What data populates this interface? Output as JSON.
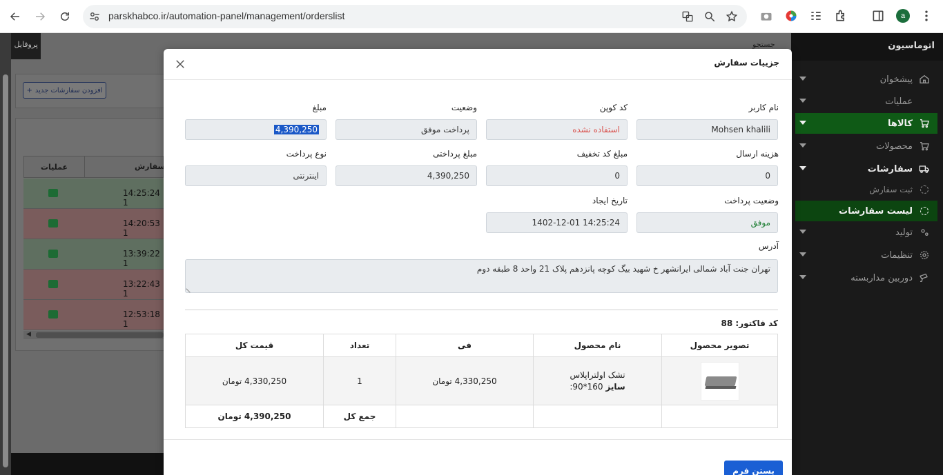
{
  "browser": {
    "url": "parskhabco.ir/automation-panel/management/orderslist",
    "avatar_letter": "a"
  },
  "background": {
    "profile_label": "پروفایل",
    "search_label": "جستجو",
    "add_order_label": "افزودن سفارشات جدید",
    "table": {
      "col_ops": "عملیات",
      "col_order": "سفارش",
      "rows": [
        {
          "time": "14:25:24 1",
          "status": "green"
        },
        {
          "time": "14:20:53 1",
          "status": "red"
        },
        {
          "time": "13:39:22 1",
          "status": "green"
        },
        {
          "time": "13:22:43 1",
          "status": "red"
        },
        {
          "time": "12:53:18 1",
          "status": "red"
        }
      ]
    }
  },
  "sidebar": {
    "brand": "اتوماسیون",
    "items": [
      {
        "label": "پیشخوان",
        "icon": "home-icon"
      },
      {
        "label": "عملیات",
        "icon": ""
      },
      {
        "label": "کالاها",
        "icon": "cart-icon"
      },
      {
        "label": "محصولات",
        "icon": "cart-icon"
      },
      {
        "label": "سفارشات",
        "icon": "truck-icon"
      },
      {
        "label": "ثبت سفارش",
        "icon": "circle-icon"
      },
      {
        "label": "لیست سفارشات",
        "icon": "circle-icon"
      },
      {
        "label": "تولید",
        "icon": "gears-icon"
      },
      {
        "label": "تنظیمات",
        "icon": "gear-icon"
      },
      {
        "label": "دوربین مداربسته",
        "icon": "camera-icon"
      }
    ]
  },
  "modal": {
    "title": "جزییات سفارش",
    "fields": {
      "username": {
        "label": "نام کاربر",
        "value": "Mohsen khalili"
      },
      "coupon": {
        "label": "کد کوپن",
        "value": "استفاده نشده"
      },
      "status": {
        "label": "وضعیت",
        "value": "پرداخت موفق"
      },
      "amount": {
        "label": "مبلغ",
        "value": "4,390,250"
      },
      "shipping": {
        "label": "هزینه ارسال",
        "value": "0"
      },
      "discount": {
        "label": "مبلغ کد تخفیف",
        "value": "0"
      },
      "paid": {
        "label": "مبلغ پرداختی",
        "value": "4,390,250"
      },
      "pay_type": {
        "label": "نوع پرداخت",
        "value": "اینترنتی"
      },
      "pay_status": {
        "label": "وضعیت پرداخت",
        "value": "موفق"
      },
      "created": {
        "label": "تاریخ ایجاد",
        "value": "1402-12-01 14:25:24"
      },
      "address": {
        "label": "آدرس",
        "value": "تهران جنت آباد شمالی ایرانشهر خ شهید بیگ کوچه پانزدهم پلاک 21 واحد 8 طبقه دوم"
      }
    },
    "invoice_label": "کد فاکتور: 88",
    "table": {
      "headers": [
        "تصویر محصول",
        "نام محصول",
        "فی",
        "تعداد",
        "قیمت کل"
      ],
      "row": {
        "name": "تشک اولتراپلاس",
        "size_label": "سایز",
        "size_value": ":90*160",
        "unit_price": "4,330,250 تومان",
        "qty": "1",
        "total": "4,330,250 تومان"
      },
      "sum_label": "جمع کل",
      "sum_value": "4,390,250 تومان"
    },
    "close_button": "بستن فرم"
  },
  "colors": {
    "sidebar_active": "#0f5a16",
    "primary_button": "#1a5fd4",
    "unused_coupon": "#d9534f",
    "success": "#1e7e34"
  }
}
